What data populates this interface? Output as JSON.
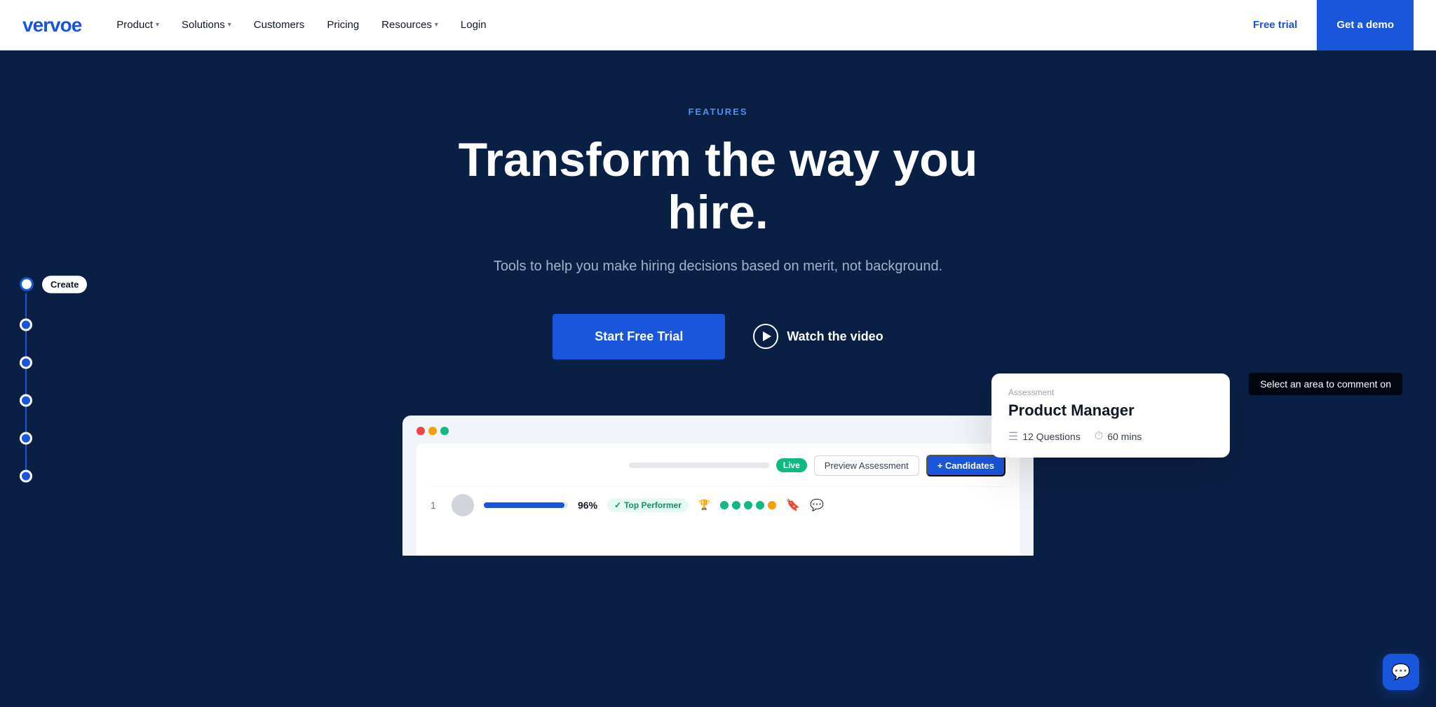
{
  "navbar": {
    "logo": "vervoe",
    "links": [
      {
        "id": "product",
        "label": "Product",
        "hasDropdown": true
      },
      {
        "id": "solutions",
        "label": "Solutions",
        "hasDropdown": true
      },
      {
        "id": "customers",
        "label": "Customers",
        "hasDropdown": false
      },
      {
        "id": "pricing",
        "label": "Pricing",
        "hasDropdown": false
      },
      {
        "id": "resources",
        "label": "Resources",
        "hasDropdown": true
      },
      {
        "id": "login",
        "label": "Login",
        "hasDropdown": false
      }
    ],
    "free_trial_label": "Free trial",
    "get_demo_label": "Get a demo"
  },
  "hero": {
    "eyebrow": "FEATURES",
    "title": "Transform the way you hire.",
    "subtitle": "Tools to help you make hiring decisions based on merit, not background.",
    "cta_primary": "Start Free Trial",
    "cta_secondary": "Watch the video",
    "comment_tooltip": "Select an area to comment on"
  },
  "side_nav": {
    "items": [
      {
        "id": "create",
        "label": "Create",
        "active": true
      },
      {
        "id": "step2",
        "label": "",
        "active": false
      },
      {
        "id": "step3",
        "label": "",
        "active": false
      },
      {
        "id": "step4",
        "label": "",
        "active": false
      },
      {
        "id": "step5",
        "label": "",
        "active": false
      },
      {
        "id": "step6",
        "label": "",
        "active": false
      }
    ]
  },
  "dashboard": {
    "tag_live": "Live",
    "btn_preview": "Preview Assessment",
    "btn_candidates": "+ Candidates",
    "candidate": {
      "rank": "1",
      "score": "96%",
      "bar_width": "96",
      "badge": "Top Performer"
    }
  },
  "assessment_card": {
    "label": "Assessment",
    "title": "Product Manager",
    "questions_label": "12 Questions",
    "time_label": "60 mins"
  }
}
